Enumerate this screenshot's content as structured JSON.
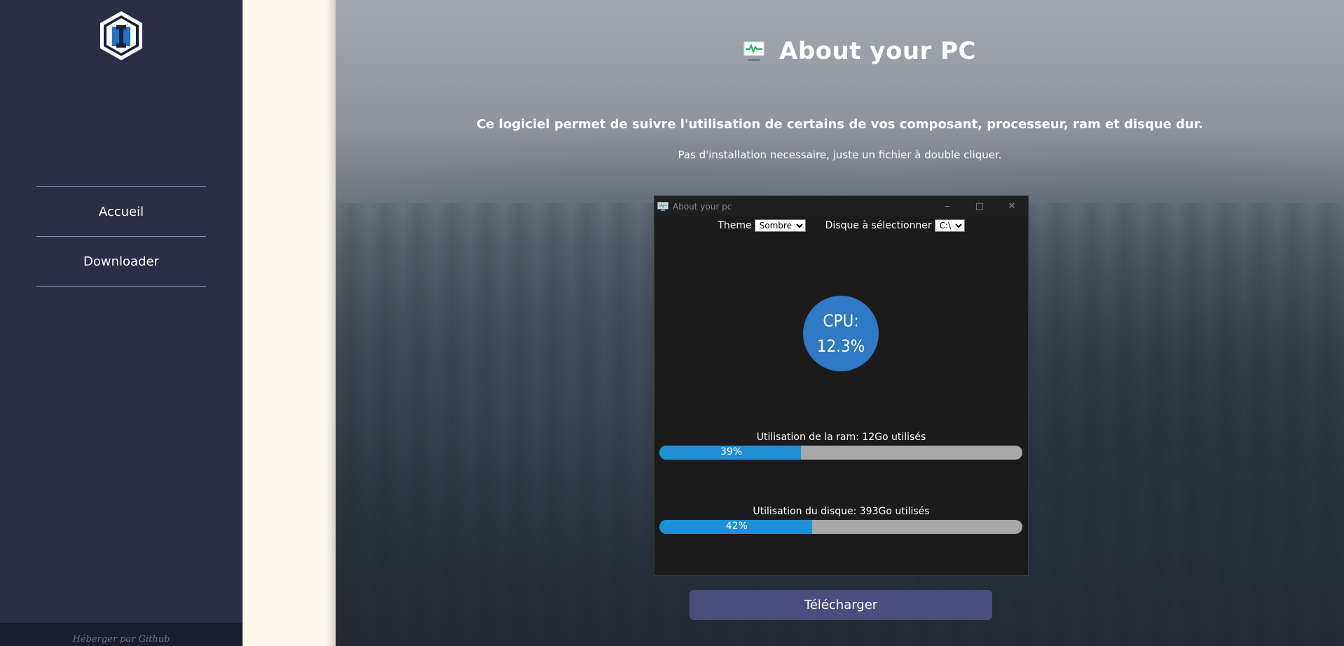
{
  "sidebar": {
    "logo_icon": "hexagon-logo-icon",
    "nav": [
      {
        "label": "Accueil"
      },
      {
        "label": "Downloader"
      }
    ],
    "footer": "Héberger par Github"
  },
  "hero": {
    "title_icon": "monitor-icon",
    "title": "About your PC",
    "subtitle": "Ce logiciel permet de suivre l'utilisation de certains de vos composant, processeur, ram et disque dur.",
    "subtitle2": "Pas d'installation necessaire, juste un fichier à double cliquer."
  },
  "app_window": {
    "title": "About your pc",
    "theme_label": "Theme",
    "theme_value": "Sombre",
    "disk_label": "Disque à sélectionner",
    "disk_value": "C:\\",
    "cpu_label": "CPU:",
    "cpu_value": "12.3%",
    "ram_label": "Utilisation de la ram: 12Go utilisés",
    "ram_percent_text": "39%",
    "ram_fraction": 0.39,
    "disk_usage_label": "Utilisation du disque: 393Go utilisés",
    "disk_percent_text": "42%",
    "disk_fraction": 0.42
  },
  "download_button": "Télécharger",
  "colors": {
    "sidebar": "#2a2e46",
    "accent_button": "#4a4d7e",
    "cpu_circle": "#2f79c6",
    "bar_fill": "#1e90d6"
  }
}
